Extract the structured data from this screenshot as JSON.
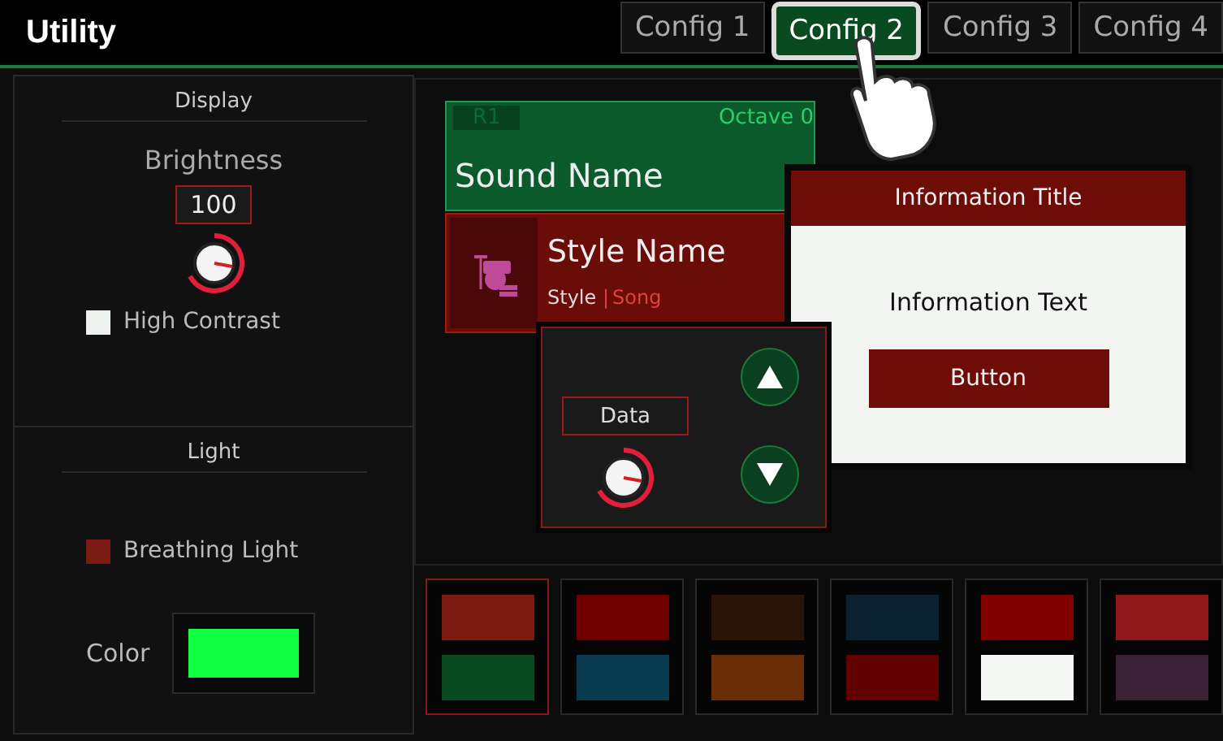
{
  "header": {
    "title": "Utility"
  },
  "tabs": [
    {
      "label": "Config 1",
      "selected": false
    },
    {
      "label": "Config 2",
      "selected": true
    },
    {
      "label": "Config 3",
      "selected": false
    },
    {
      "label": "Config 4",
      "selected": false
    }
  ],
  "display": {
    "heading": "Display",
    "brightness_label": "Brightness",
    "brightness_value": "100",
    "high_contrast": {
      "label": "High Contrast",
      "checked": false
    }
  },
  "light": {
    "heading": "Light",
    "breathing": {
      "label": "Breathing Light",
      "checked": true
    },
    "color_label": "Color",
    "color": "#10ff40"
  },
  "sound_card": {
    "part": "R1",
    "octave": "Octave 0",
    "name": "Sound Name"
  },
  "style_card": {
    "name": "Style Name",
    "tag": "Style",
    "separator": "|",
    "song": "Song"
  },
  "data_panel": {
    "label": "Data"
  },
  "dialog": {
    "title": "Information Title",
    "text": "Information Text",
    "button": "Button"
  },
  "swatches": [
    {
      "selected": true,
      "chips": [
        {
          "color": "#7a1a10"
        },
        {
          "color": "#0a4a20"
        }
      ]
    },
    {
      "selected": false,
      "chips": [
        {
          "color": "#700000"
        },
        {
          "color": "#083a50"
        }
      ]
    },
    {
      "selected": false,
      "chips": [
        {
          "color": "#2a1408"
        },
        {
          "color": "#6a2e06"
        }
      ]
    },
    {
      "selected": false,
      "chips": [
        {
          "color": "#0a2230"
        },
        {
          "color": "#600000"
        }
      ]
    },
    {
      "selected": false,
      "chips": [
        {
          "color": "#800000"
        },
        {
          "color": "#f5f8f5"
        }
      ]
    },
    {
      "selected": false,
      "chips": [
        {
          "color": "#901818"
        },
        {
          "color": "#3a2035"
        }
      ]
    }
  ]
}
